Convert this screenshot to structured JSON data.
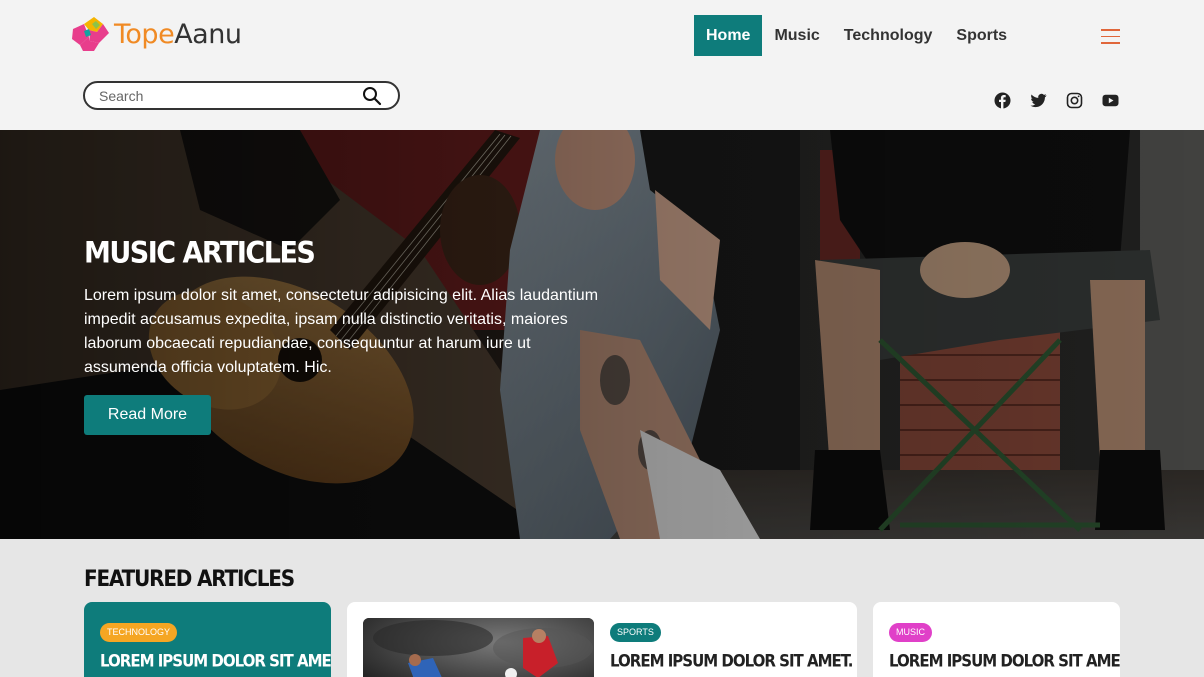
{
  "brand": {
    "name_part1": "Tope",
    "name_part2": "Aanu",
    "logo_colors": [
      "#e83e8c",
      "#f5b400",
      "#12a4a1",
      "#8bc34a"
    ]
  },
  "nav": {
    "items": [
      {
        "label": "Home",
        "active": true
      },
      {
        "label": "Music",
        "active": false
      },
      {
        "label": "Technology",
        "active": false
      },
      {
        "label": "Sports",
        "active": false
      }
    ],
    "menu_icon": "hamburger-icon"
  },
  "search": {
    "placeholder": "Search",
    "value": "",
    "icon": "search-icon"
  },
  "social": [
    "facebook-icon",
    "twitter-icon",
    "instagram-icon",
    "youtube-icon"
  ],
  "hero": {
    "title": "MUSIC ARTICLES",
    "text": "Lorem ipsum dolor sit amet, consectetur adipisicing elit. Alias laudantium impedit accusamus expedita, ipsam nulla distinctio veritatis, maiores laborum obcaecati repudiandae, consequuntur at harum iure ut assumenda officia voluptatem. Hic.",
    "button": "Read More"
  },
  "featured": {
    "title": "FEATURED ARTICLES",
    "cards": [
      {
        "category": "TECHNOLOGY",
        "title": "LOREM IPSUM DOLOR SIT AMET.",
        "badge_color": "#f5a623"
      },
      {
        "category": "SPORTS",
        "title": "LOREM IPSUM DOLOR SIT AMET.",
        "badge_color": "#0e7c7b"
      },
      {
        "category": "MUSIC",
        "title": "LOREM IPSUM DOLOR SIT AMET.",
        "badge_color": "#e040c8"
      }
    ]
  },
  "colors": {
    "accent": "#0e7c7b",
    "logo_orange": "#f08a24",
    "menu_icon": "#e0663a"
  }
}
